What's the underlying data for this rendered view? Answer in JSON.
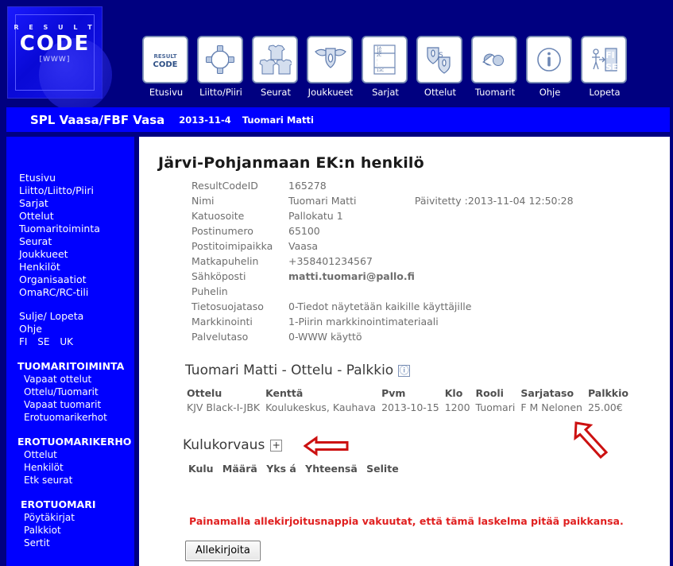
{
  "logo": {
    "top_text": "R E S U L T",
    "main_text": "CODE",
    "sub_text": "[WWW]"
  },
  "topnav": {
    "items": [
      {
        "label": "Etusivu",
        "icon": "resultcode-logo-icon"
      },
      {
        "label": "Liitto/Piiri",
        "icon": "network-circle-icon"
      },
      {
        "label": "Seurat",
        "icon": "jerseys-group-icon"
      },
      {
        "label": "Joukkueet",
        "icon": "flag-shield-icon"
      },
      {
        "label": "Sarjat",
        "icon": "standings-list-icon"
      },
      {
        "label": "Ottelut",
        "icon": "two-shields-match-icon"
      },
      {
        "label": "Tuomarit",
        "icon": "whistle-icon"
      },
      {
        "label": "Ohje",
        "icon": "info-circle-icon"
      },
      {
        "label": "Lopeta",
        "icon": "exit-door-icon"
      }
    ],
    "languages": [
      "FI",
      "SE",
      "UK"
    ]
  },
  "titlebar": {
    "org": "SPL Vaasa/FBF Vasa",
    "date": "2013-11-4",
    "user": "Tuomari Matti"
  },
  "sidebar": {
    "main_links": [
      "Etusivu",
      "Liitto/Liitto/Piiri",
      "Sarjat",
      "Ottelut",
      "Tuomaritoiminta",
      "Seurat",
      "Joukkueet",
      "Henkilöt",
      "Organisaatiot",
      "OmaRC/RC-tili"
    ],
    "account_links": [
      "Sulje/ Lopeta",
      "Ohje"
    ],
    "languages": [
      "FI",
      "SE",
      "UK"
    ],
    "groups": [
      {
        "heading": "TUOMARITOIMINTA",
        "items": [
          "Vapaat ottelut",
          "Ottelu/Tuomarit",
          "Vapaat tuomarit",
          "Erotuomarikerhot"
        ]
      },
      {
        "heading": "EROTUOMARIKERHO",
        "items": [
          "Ottelut",
          "Henkilöt",
          "Etk seurat"
        ]
      },
      {
        "heading": "EROTUOMARI",
        "items": [
          "Pöytäkirjat",
          "Palkkiot",
          "Sertit"
        ]
      }
    ]
  },
  "main": {
    "page_title": "Järvi-Pohjanmaan EK:n henkilö",
    "person_fields": [
      {
        "label": "ResultCodeID",
        "value": "165278",
        "strong": false,
        "extra": ""
      },
      {
        "label": "Nimi",
        "value": "Tuomari Matti",
        "strong": false,
        "extra": "Päivitetty :2013-11-04 12:50:28"
      },
      {
        "label": "Katuosoite",
        "value": "Pallokatu 1",
        "strong": false,
        "extra": ""
      },
      {
        "label": "Postinumero",
        "value": "65100",
        "strong": false,
        "extra": ""
      },
      {
        "label": "Postitoimipaikka",
        "value": "Vaasa",
        "strong": false,
        "extra": ""
      },
      {
        "label": "Matkapuhelin",
        "value": "+358401234567",
        "strong": false,
        "extra": ""
      },
      {
        "label": "Sähköposti",
        "value": "matti.tuomari@pallo.fi",
        "strong": true,
        "extra": ""
      },
      {
        "label": "Puhelin",
        "value": "",
        "strong": false,
        "extra": ""
      },
      {
        "label": "Tietosuojataso",
        "value": "0-Tiedot näytetään kaikille käyttäjille",
        "strong": false,
        "extra": ""
      },
      {
        "label": "Markkinointi",
        "value": "1-Piirin markkinointimateriaali",
        "strong": false,
        "extra": ""
      },
      {
        "label": "Palvelutaso",
        "value": "0-WWW käyttö",
        "strong": false,
        "extra": ""
      }
    ],
    "palkkio": {
      "heading": "Tuomari Matti - Ottelu - Palkkio",
      "info_icon": "ⓘ",
      "columns": [
        "Ottelu",
        "Kenttä",
        "Pvm",
        "Klo",
        "Rooli",
        "Sarjataso",
        "Palkkio"
      ],
      "rows": [
        [
          "KJV Black-I-JBK",
          "Koulukeskus, Kauhava",
          "2013-10-15",
          "1200",
          "Tuomari",
          "F M Nelonen",
          "25.00€"
        ]
      ]
    },
    "kulukorvaus": {
      "heading": "Kulukorvaus",
      "add_label": "+",
      "columns": [
        "Kulu",
        "Määrä",
        "Yks á",
        "Yhteensä",
        "Selite"
      ],
      "rows": []
    },
    "confirm_text": "Painamalla allekirjoitusnappia vakuutat, että tämä laskelma pitää paikkansa.",
    "sign_button": "Allekirjoita"
  },
  "annotations": {
    "arrow_left": "red-left-arrow",
    "arrow_diagonal": "red-diagonal-arrow",
    "color": "#cc1111"
  },
  "colors": {
    "page_bg": "#000080",
    "bar_blue": "#0000ff",
    "content_bg": "#ffffff",
    "alert_red": "#e02020"
  }
}
